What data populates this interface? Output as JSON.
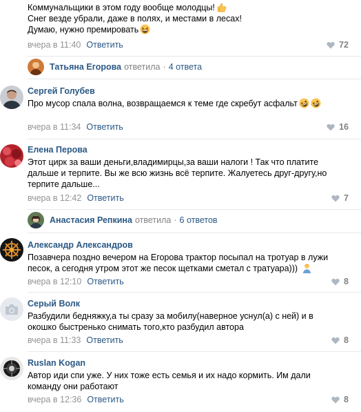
{
  "comments": [
    {
      "text_lines": [
        "Коммунальщики в этом году вообще молодцы!",
        "Снег везде убрали, даже в полях, и местами в лесах!",
        "Думаю, нужно премировать"
      ],
      "time": "вчера в 11:40",
      "reply": "Ответить",
      "likes": "72"
    },
    {
      "author": "Сергей Голубев",
      "text_lines": [
        "Про мусор спала волна, возвращаемся к теме где скребут асфальт"
      ],
      "time": "вчера в 11:34",
      "reply": "Ответить",
      "likes": "16"
    },
    {
      "author": "Елена Перова",
      "text_lines": [
        "Этот цирк за ваши деньги,владимирцы,за ваши налоги ! Так что платите",
        "дальше и терпите. Вы же всю жизнь всё терпите. Жалуетесь друг-другу,но",
        "терпите дальше..."
      ],
      "time": "вчера в 12:42",
      "reply": "Ответить",
      "likes": "7"
    },
    {
      "author": "Александр Александров",
      "text_lines": [
        "Позавчера поздно вечером на Егорова трактор посыпал на тротуар в лужи",
        "песок, а сегодня утром этот же песок щетками сметал с тратуара)))"
      ],
      "time": "вчера в 12:10",
      "reply": "Ответить",
      "likes": "8"
    },
    {
      "author": "Серый Волк",
      "text_lines": [
        "Разбудили бедняжку,а ты сразу за мобилу(наверное уснул(а) с ней) и в",
        "окошко быстренько снимать того,кто разбудил автора"
      ],
      "time": "вчера в 11:33",
      "reply": "Ответить",
      "likes": "8"
    },
    {
      "author": "Ruslan Kogan",
      "text_lines": [
        "Автор иди спи уже. У них тоже есть семья и их надо кормить. Им дали",
        "команду они работают"
      ],
      "time": "вчера в 12:36",
      "reply": "Ответить",
      "likes": "8"
    }
  ],
  "threads": [
    {
      "name": "Татьяна Егорова",
      "verb": "ответила",
      "dot": "·",
      "count": "4 ответа"
    },
    {
      "name": "Анастасия Репкина",
      "verb": "ответила",
      "dot": "·",
      "count": "6 ответов"
    }
  ],
  "icons": {
    "thumbs_up": "thumbs-up-emoji",
    "grinning": "grinning-squinting-emoji",
    "rofl": "rolling-laughing-emoji",
    "person": "person-emoji",
    "heart": "heart-icon",
    "camera": "camera-icon"
  },
  "colors": {
    "link": "#2a5885",
    "meta": "#939393",
    "separator": "#e7e8ec"
  }
}
